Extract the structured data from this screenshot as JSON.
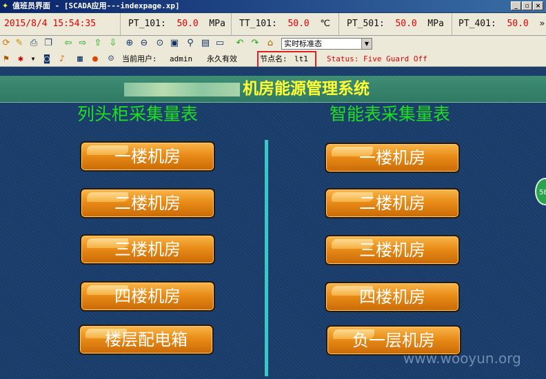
{
  "window": {
    "title": "值班员界面 - [SCADA应用---indexpage.xp]",
    "icon": "app-icon",
    "controls": [
      "_",
      "▫",
      "×"
    ]
  },
  "status": {
    "datetime": "2015/8/4 15:54:35",
    "readings": [
      {
        "tag": "PT_101:",
        "value": "50.0",
        "unit": "MPa"
      },
      {
        "tag": "TT_101:",
        "value": "50.0",
        "unit": "℃"
      },
      {
        "tag": "PT_501:",
        "value": "50.0",
        "unit": "MPa"
      },
      {
        "tag": "PT_401:",
        "value": "50.0",
        "unit": "»"
      }
    ]
  },
  "toolbar": {
    "mode_select": "实时标准态",
    "icons": [
      "refresh-icon",
      "edit-icon",
      "print-icon",
      "copy-icon",
      "arrow-left-icon",
      "arrow-right-icon",
      "arrow-up-icon",
      "arrow-down-icon",
      "zoom-in-icon",
      "zoom-out-icon",
      "zoom-fit-icon",
      "zoom-area-icon",
      "search-icon",
      "chart-icon",
      "window-icon",
      "back-icon",
      "forward-icon",
      "home-icon"
    ]
  },
  "info": {
    "user_label": "当前用户:",
    "user": "admin",
    "validity": "永久有效",
    "node_label": "节点名:",
    "node": "lt1",
    "status_text": "Status: Five Guard Off"
  },
  "main": {
    "system_title": "机房能源管理系统",
    "left_title": "列头柜采集量表",
    "right_title": "智能表采集量表",
    "left_buttons": [
      "一楼机房",
      "二楼机房",
      "三楼机房",
      "四楼机房",
      "楼层配电箱"
    ],
    "right_buttons": [
      "一楼机房",
      "二楼机房",
      "三楼机房",
      "四楼机房",
      "负一层机房"
    ],
    "side_badge": "58"
  },
  "watermark": "www.wooyun.org",
  "colors": {
    "status_value": "#e00000",
    "section_title": "#1fe01f",
    "system_title": "#ffff33",
    "button": "#e98c18",
    "divider": "#39c7c7",
    "highlight": "#e02020"
  }
}
